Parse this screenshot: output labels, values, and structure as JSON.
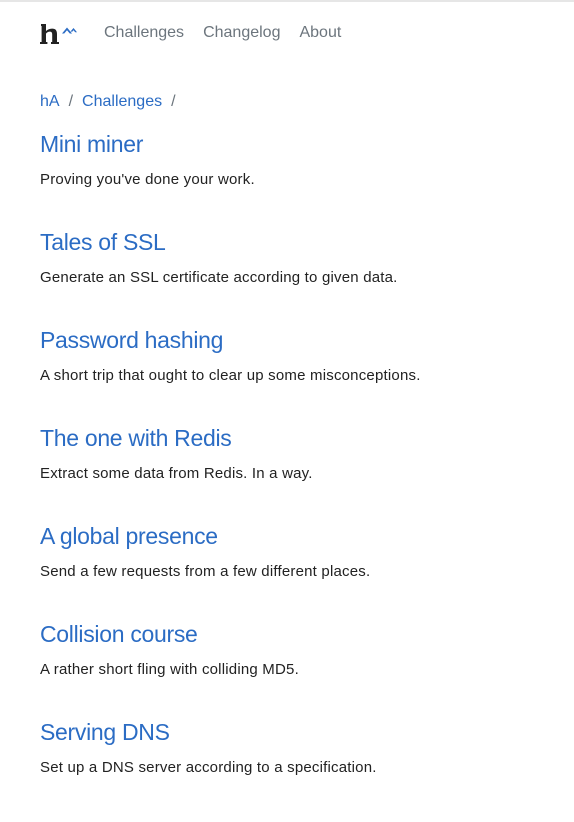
{
  "nav": {
    "logo_alt": "h^",
    "links": [
      {
        "label": "Challenges"
      },
      {
        "label": "Changelog"
      },
      {
        "label": "About"
      }
    ]
  },
  "breadcrumb": {
    "items": [
      {
        "label": "hA"
      },
      {
        "label": "Challenges"
      }
    ],
    "separator": "/"
  },
  "challenges": [
    {
      "title": "Mini miner",
      "description": "Proving you've done your work."
    },
    {
      "title": "Tales of SSL",
      "description": "Generate an SSL certificate according to given data."
    },
    {
      "title": "Password hashing",
      "description": "A short trip that ought to clear up some misconceptions."
    },
    {
      "title": "The one with Redis",
      "description": "Extract some data from Redis. In a way."
    },
    {
      "title": "A global presence",
      "description": "Send a few requests from a few different places."
    },
    {
      "title": "Collision course",
      "description": "A rather short fling with colliding MD5."
    },
    {
      "title": "Serving DNS",
      "description": "Set up a DNS server according to a specification."
    }
  ],
  "colors": {
    "link": "#2b6cc4",
    "nav_text": "#6c757d",
    "body_text": "#222222"
  }
}
